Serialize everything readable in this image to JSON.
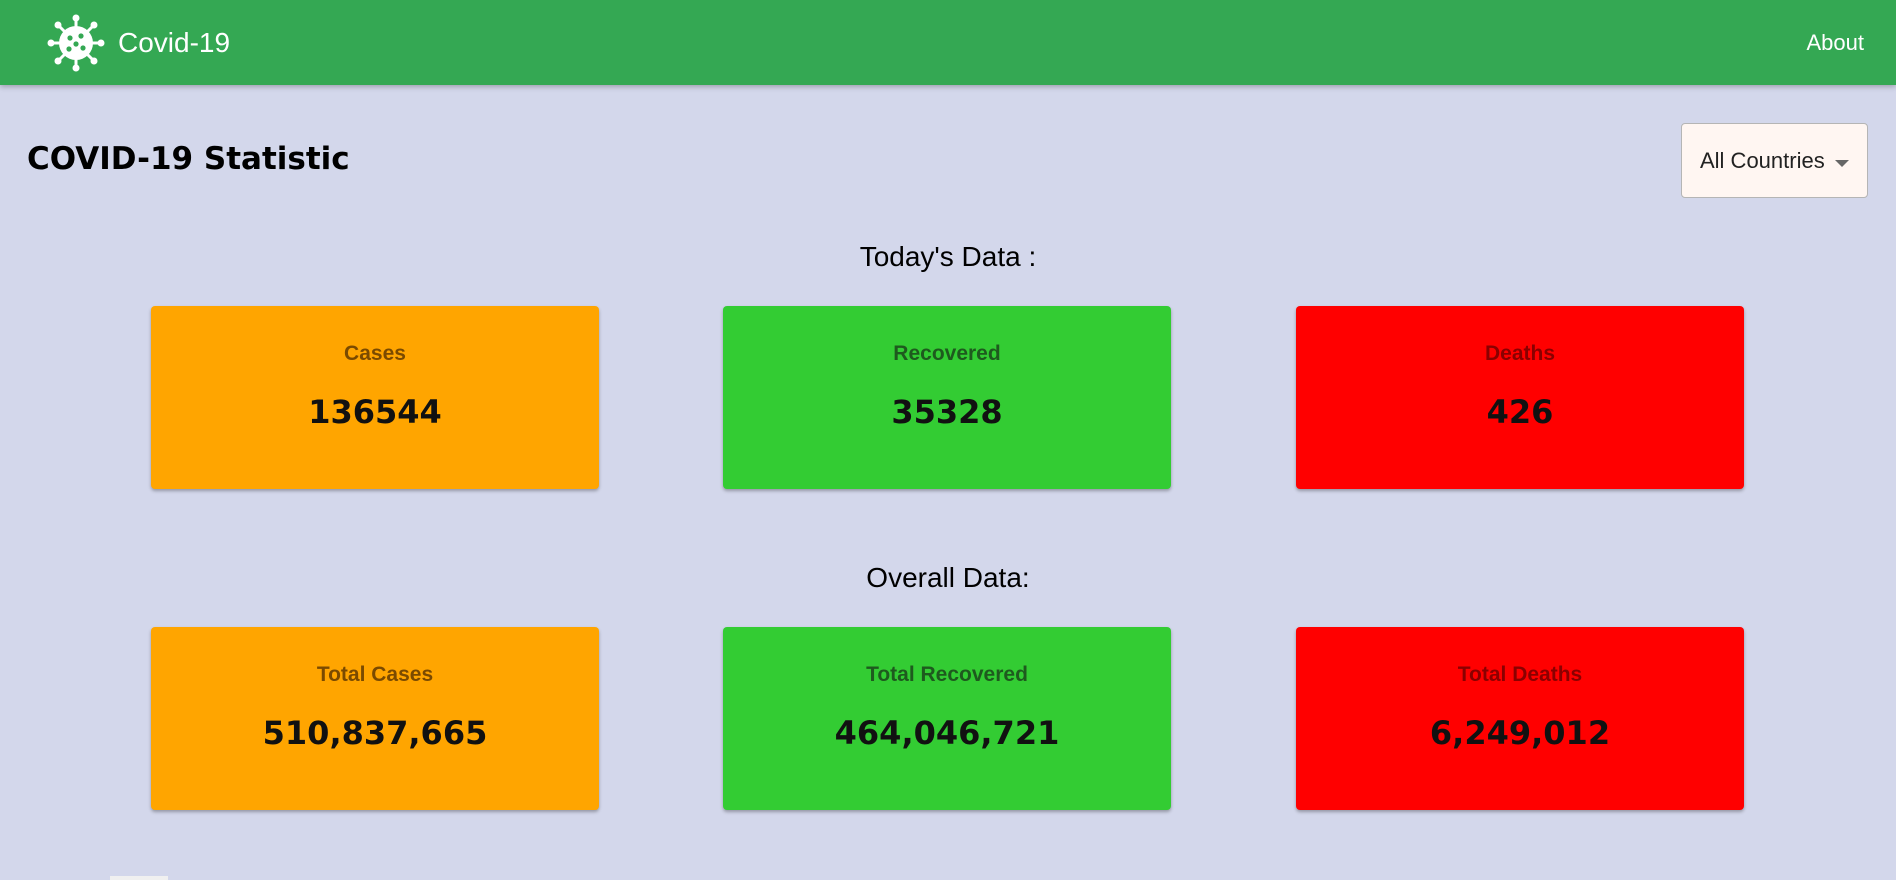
{
  "navbar": {
    "brand_title": "Covid-19",
    "brand_icon": "virus-icon",
    "about_label": "About",
    "background_color": "#34a853"
  },
  "page": {
    "title": "COVID-19 Statistic",
    "background_color": "#d3d7eb"
  },
  "country_select": {
    "selected": "All Countries"
  },
  "today": {
    "heading": "Today's Data :",
    "cards": [
      {
        "label": "Cases",
        "value": "136544",
        "color": "#ffa500"
      },
      {
        "label": "Recovered",
        "value": "35328",
        "color": "#33cc33"
      },
      {
        "label": "Deaths",
        "value": "426",
        "color": "#ff0000"
      }
    ]
  },
  "overall": {
    "heading": "Overall Data:",
    "cards": [
      {
        "label": "Total Cases",
        "value": "510,837,665",
        "color": "#ffa500"
      },
      {
        "label": "Total Recovered",
        "value": "464,046,721",
        "color": "#33cc33"
      },
      {
        "label": "Total Deaths",
        "value": "6,249,012",
        "color": "#ff0000"
      }
    ]
  }
}
